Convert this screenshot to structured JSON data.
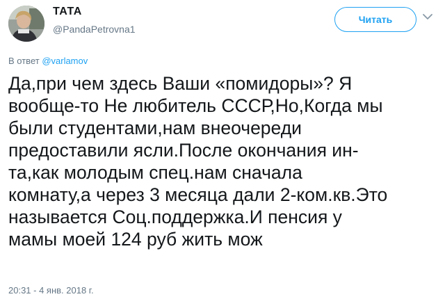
{
  "tweet": {
    "display_name": "ТАТА",
    "handle": "@PandaPetrovna1",
    "follow_label": "Читать",
    "reply_prefix": "В ответ ",
    "reply_to": "@varlamov",
    "text": "Да,при чем здесь Ваши «помидоры»? Я\nвообще-то Не любитель СССР,Но,Когда мы\nбыли студентами,нам внеочереди\nпредоставили ясли.После окончания ин-\nта,как молодым спец.нам сначала\nкомнату,а через 3 месяца дали 2-ком.кв.Это\nназывается Соц.поддержка.И пенсия у\nмамы моей 124 руб жить мож",
    "timestamp": "20:31 - 4 янв. 2018 г."
  },
  "colors": {
    "accent": "#1da1f2",
    "secondary_text": "#657786",
    "primary_text": "#14171a"
  },
  "icons": {
    "avatar": "user-photo",
    "caret": "chevron-down-icon"
  }
}
